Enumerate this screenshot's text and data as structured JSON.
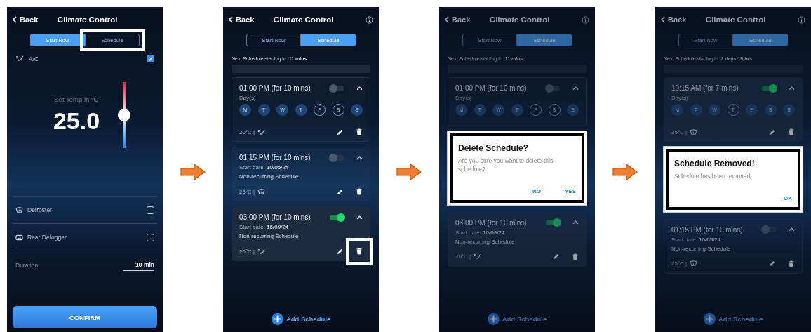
{
  "screens": [
    {
      "kind": "start_now",
      "dimmed": false,
      "header": {
        "back": "Back",
        "title": "Climate Control",
        "info": false
      },
      "tabs": [
        {
          "label": "Start Now",
          "selected": true,
          "highlighted": false
        },
        {
          "label": "Schedule",
          "selected": false,
          "highlighted": true
        }
      ],
      "ac": {
        "label": "A/C",
        "checked": true
      },
      "temp": {
        "label": "Set Temp in **°C**",
        "value": "25.0",
        "level": 0.5
      },
      "options": [
        {
          "kind": "defroster",
          "label": "Defroster",
          "checked": false
        },
        {
          "kind": "defogger",
          "label": "Rear Defogger",
          "checked": false
        }
      ],
      "duration": {
        "label": "Duration",
        "value": "10 min"
      },
      "confirm": "CONFIRM"
    },
    {
      "kind": "schedule_list",
      "dimmed": false,
      "header": {
        "back": "Back",
        "title": "Climate Control",
        "info": true
      },
      "tabs": [
        {
          "label": "Start Now",
          "selected": false,
          "highlighted": false
        },
        {
          "label": "Schedule",
          "selected": true,
          "highlighted": false
        }
      ],
      "next": "Next Schedule starting in: **11 mins**",
      "cards": [
        {
          "kind": "schedule",
          "time": "01:00 PM (for 10 mins)",
          "on": false,
          "days_label": "Day(s)",
          "days": [
            {
              "label": "M",
              "selected": true
            },
            {
              "label": "T",
              "selected": true
            },
            {
              "label": "W",
              "selected": true
            },
            {
              "label": "T",
              "selected": true
            },
            {
              "label": "F",
              "selected": false
            },
            {
              "label": "S",
              "selected": false
            },
            {
              "label": "S",
              "selected": true
            }
          ],
          "temp": "20°C |",
          "mode": {
            "kind": "ac"
          },
          "delete_highlighted": false
        },
        {
          "kind": "schedule",
          "time": "01:15 PM (for 10 mins)",
          "on": false,
          "start_label": "Start date:",
          "start_date": "10/05/24",
          "recurrence": "Non-recurring Schedule",
          "temp": "25°C |",
          "mode": {
            "kind": "defroster"
          },
          "delete_highlighted": false
        },
        {
          "kind": "schedule",
          "time": "03:00 PM (for 10 mins)",
          "on": true,
          "start_label": "Start date:",
          "start_date": "16/09/24",
          "recurrence": "Non-recurring Schedule",
          "temp": "20°C |",
          "mode": {
            "kind": "ac"
          },
          "delete_highlighted": true
        }
      ],
      "add": "Add Schedule"
    },
    {
      "kind": "schedule_list",
      "dimmed": true,
      "header": {
        "back": "Back",
        "title": "Climate Control",
        "info": true
      },
      "tabs": [
        {
          "label": "Start Now",
          "selected": false,
          "highlighted": false
        },
        {
          "label": "Schedule",
          "selected": true,
          "highlighted": false
        }
      ],
      "next": "Next Schedule starting in: **11 mins**",
      "cards": [
        {
          "kind": "schedule",
          "time": "01:00 PM (for 10 mins)",
          "on": false,
          "days_label": "Day(s)",
          "days": [
            {
              "label": "M",
              "selected": true
            },
            {
              "label": "T",
              "selected": true
            },
            {
              "label": "W",
              "selected": true
            },
            {
              "label": "T",
              "selected": true
            },
            {
              "label": "F",
              "selected": false
            },
            {
              "label": "S",
              "selected": false
            },
            {
              "label": "S",
              "selected": true
            }
          ]
        },
        {
          "kind": "dialog",
          "title": "Delete Schedule?",
          "message": "Are you sure you want to delete this schedule?",
          "buttons": [
            "NO",
            "YES"
          ]
        },
        {
          "kind": "schedule",
          "time": "03:00 PM (for 10 mins)",
          "on": true,
          "start_label": "Start date:",
          "start_date": "16/09/24",
          "recurrence": "Non-recurring Schedule",
          "temp": "20°C |",
          "mode": {
            "kind": "ac"
          },
          "delete_highlighted": false
        }
      ],
      "add": "Add Schedule"
    },
    {
      "kind": "schedule_list",
      "dimmed": true,
      "header": {
        "back": "Back",
        "title": "Climate Control",
        "info": true
      },
      "tabs": [
        {
          "label": "Start Now",
          "selected": false,
          "highlighted": false
        },
        {
          "label": "Schedule",
          "selected": true,
          "highlighted": false
        }
      ],
      "next": "Next Schedule starting in: **2 days 19 hrs**",
      "cards": [
        {
          "kind": "schedule",
          "time": "10:15 AM (for 7 mins)",
          "on": true,
          "days_label": "Day(s)",
          "days": [
            {
              "label": "M",
              "selected": true
            },
            {
              "label": "T",
              "selected": true
            },
            {
              "label": "W",
              "selected": true
            },
            {
              "label": "T",
              "selected": false
            },
            {
              "label": "F",
              "selected": true
            },
            {
              "label": "S",
              "selected": true
            },
            {
              "label": "S",
              "selected": true
            }
          ],
          "temp": "25°C |",
          "mode": {
            "kind": "defroster"
          },
          "delete_highlighted": false
        },
        {
          "kind": "dialog",
          "title": "Schedule Removed!",
          "message": "Schedule has been removed.",
          "buttons": [
            "OK"
          ]
        },
        {
          "kind": "schedule",
          "time": "01:15 PM (for 10 mins)",
          "on": false,
          "start_label": "Start date:",
          "start_date": "10/05/24",
          "recurrence": "Non-recurring Schedule",
          "temp": "25°C |",
          "mode": {
            "kind": "defroster"
          },
          "delete_highlighted": false
        }
      ],
      "add": "Add Schedule"
    }
  ]
}
